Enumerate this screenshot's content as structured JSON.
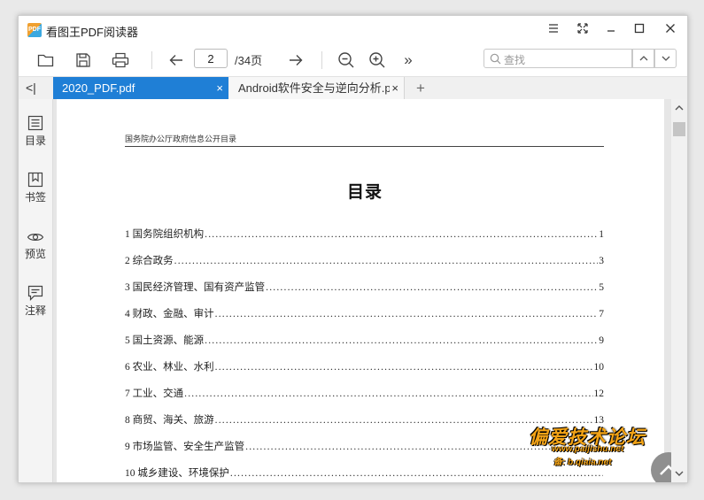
{
  "app": {
    "logo_text": "PDF",
    "title": "看图王PDF阅读器"
  },
  "window_controls": {
    "menu_icon": "menu-icon",
    "fullscreen_icon": "fullscreen-icon",
    "minimize_icon": "minimize-icon",
    "maximize_icon": "maximize-icon",
    "close_icon": "close-icon"
  },
  "toolbar": {
    "current_page": "2",
    "total_pages": "/34页",
    "more_label": "»"
  },
  "search": {
    "placeholder": "查找"
  },
  "tabs": [
    {
      "label": "2020_PDF.pdf",
      "active": true,
      "close": "×"
    },
    {
      "label": "Android软件安全与逆向分析.pc",
      "active": false,
      "close": "×"
    }
  ],
  "tabbar": {
    "collapse_label": "<|",
    "add_tab_label": "+"
  },
  "sidebar": {
    "items": [
      {
        "label": "目录",
        "icon": "toc-icon"
      },
      {
        "label": "书签",
        "icon": "bookmark-icon"
      },
      {
        "label": "预览",
        "icon": "eye-icon"
      },
      {
        "label": "注释",
        "icon": "comment-icon"
      }
    ]
  },
  "document": {
    "header": "国务院办公厅政府信息公开目录",
    "title": "目录",
    "toc": [
      {
        "label": "1 国务院组织机构",
        "page": "1"
      },
      {
        "label": "2 综合政务",
        "page": "3"
      },
      {
        "label": "3 国民经济管理、国有资产监管",
        "page": "5"
      },
      {
        "label": "4 财政、金融、审计",
        "page": "7"
      },
      {
        "label": "5 国土资源、能源",
        "page": "9"
      },
      {
        "label": "6 农业、林业、水利",
        "page": "10"
      },
      {
        "label": "7 工业、交通",
        "page": "12"
      },
      {
        "label": "8 商贸、海关、旅游",
        "page": "13"
      },
      {
        "label": "9 市场监管、安全生产监管",
        "page": ""
      },
      {
        "label": "10 城乡建设、环境保护",
        "page": ""
      }
    ]
  },
  "watermark": {
    "main": "偏爱技术论坛",
    "url": "www.paijishu.net",
    "sub": "备: b.qiaia.net"
  },
  "colors": {
    "accent": "#1f7fd6",
    "watermark": "#f3a316"
  }
}
